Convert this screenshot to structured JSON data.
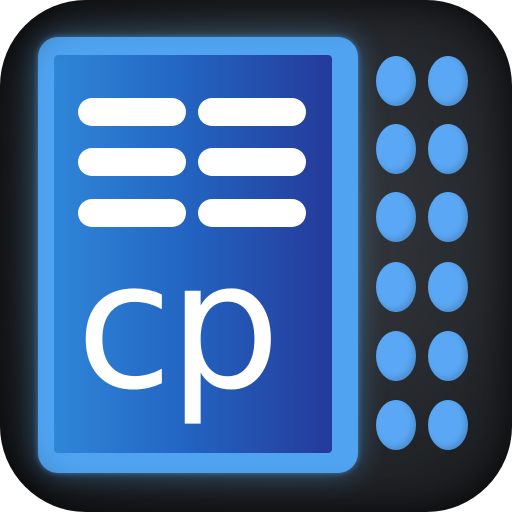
{
  "logo": {
    "text": "cp"
  },
  "colors": {
    "frame": "#4fa3f0",
    "screen_start": "#2f86d8",
    "screen_end": "#243a9a",
    "dots": "#5aa8f5",
    "background": "#25282c",
    "bars": "#ffffff"
  },
  "icons": {
    "display_bars": "horizontal-bar-icon",
    "keypad_dots": "keypad-dot-icon"
  }
}
